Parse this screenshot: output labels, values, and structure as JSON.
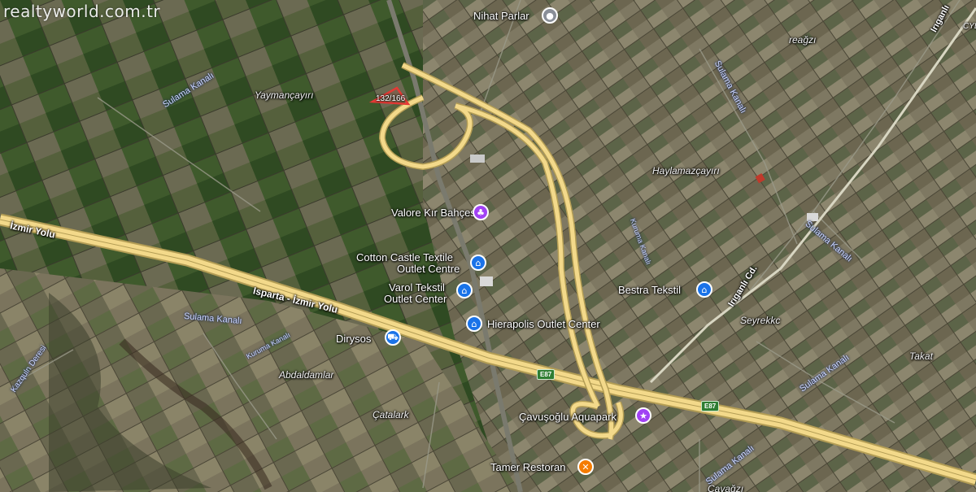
{
  "watermark": "realtyworld.com.tr",
  "parcel": {
    "label": "132/166"
  },
  "roads": {
    "highway": "Isparta - İzmir Yolu",
    "highway_west": "İzmir Yolu",
    "irigan_north": "Irıganlı",
    "irigan_cd": "Irıganlı Cd.",
    "e87_a": "E87",
    "e87_b": "E87"
  },
  "areas": {
    "yaymancayiri": "Yaymançayırı",
    "haylamazcayiri": "Haylamazçayırı",
    "seyrekkc": "Seyrekkc",
    "abdaldamlar": "Abdaldamlar",
    "catalark": "Çatalark",
    "takat": "Takat",
    "reagzi": "reağzı",
    "cavagzi": "Çavağzı",
    "cyl": "CYL"
  },
  "canals": {
    "c1": "Sulama Kanalı",
    "c2": "Sulama Kanalı",
    "c3": "Sulama Kanalı",
    "c4": "Sulama Kanalı",
    "c5": "Sulama Kanalı",
    "kurudere": "Kazquln Deresi",
    "kuruma1": "Kuruma Kanalı",
    "kuruma2": "Kuruma Kanalı"
  },
  "pois": {
    "nihat": "Nihat Parlar",
    "valore": "Valore Kır Bahçesi",
    "cotton1": "Cotton Castle Textile",
    "cotton2": "Outlet Centre",
    "varol1": "Varol Tekstil",
    "varol2": "Outlet Center",
    "hierapolis": "Hierapolis Outlet Center",
    "dirysos": "Dirysos",
    "bestra": "Bestra Tekstil",
    "aquapark": "Çavuşoğlu Aquapark",
    "tamer": "Tamer Restoran"
  },
  "icons": {
    "nihat": "place-icon",
    "valore": "park-icon",
    "cotton": "shopping-bag-icon",
    "varol": "shopping-bag-icon",
    "hierapolis": "shopping-bag-icon",
    "dirysos": "shopping-cart-icon",
    "bestra": "shopping-bag-icon",
    "aquapark": "attraction-icon",
    "tamer": "restaurant-icon"
  },
  "colors": {
    "road": "#f3d98a",
    "road_outline": "#b39d55",
    "parcel": "#e53935",
    "poi_blue": "#1a73e8",
    "poi_purple": "#a142f4",
    "poi_orange": "#f57c00"
  }
}
